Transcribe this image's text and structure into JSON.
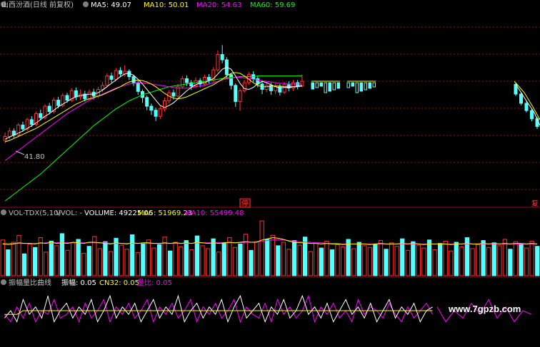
{
  "colors": {
    "up": "#ff3232",
    "down": "#54ffff",
    "ma5": "#ffffff",
    "ma10": "#ffff00",
    "ma20": "#ff00ff",
    "ma60": "#00ff00",
    "label": "#c0c0c0",
    "grid": "#8a1212",
    "watermark": "#ffffff"
  },
  "main_panel": {
    "title": "山西汾酒(日线 前复权)",
    "ma": [
      {
        "label": "MA5: 49.07",
        "color": "#ffffff"
      },
      {
        "label": "MA10: 50.01",
        "color": "#ffff00"
      },
      {
        "label": "MA20: 54.63",
        "color": "#ff00ff"
      },
      {
        "label": "MA60: 59.69",
        "color": "#00ff00"
      }
    ],
    "low_label": "41.80",
    "stop_tag": "停",
    "right_tag": "复"
  },
  "vol_panel": {
    "title": "VOL-TDX(5,10)",
    "vvol": "VVOL: -",
    "items": [
      {
        "label": "VOLUME: 49225.06",
        "color": "#ffffff"
      },
      {
        "label": "MA5: 51969.23",
        "color": "#ffff00"
      },
      {
        "label": "MA10: 55499.48",
        "color": "#ff00ff"
      }
    ]
  },
  "osc_panel": {
    "title": "振幅量比曲线",
    "items": [
      {
        "label": "振幅: 0.05",
        "color": "#ffffff"
      },
      {
        "label": "CN32: 0.05",
        "color": "#ffff00"
      },
      {
        "label": "量比: 0.05",
        "color": "#ff00ff"
      }
    ]
  },
  "watermark": "www.7gpzb.com",
  "chart_data": {
    "type": "candlestick",
    "price_range": [
      38,
      66
    ],
    "candles": [
      [
        47.0,
        47.6,
        48.2,
        46.6
      ],
      [
        47.6,
        48.4,
        48.9,
        47.2
      ],
      [
        48.4,
        47.8,
        48.8,
        47.4
      ],
      [
        47.8,
        49.3,
        49.6,
        47.5
      ],
      [
        49.3,
        48.7,
        49.8,
        48.3
      ],
      [
        48.7,
        50.1,
        50.4,
        48.4
      ],
      [
        50.1,
        49.4,
        50.6,
        49.0
      ],
      [
        49.4,
        51.0,
        51.3,
        49.1
      ],
      [
        51.0,
        50.4,
        51.6,
        50.0
      ],
      [
        50.4,
        52.1,
        52.4,
        50.1
      ],
      [
        52.1,
        51.3,
        52.6,
        50.9
      ],
      [
        51.3,
        53.0,
        53.4,
        51.0
      ],
      [
        53.0,
        52.2,
        53.5,
        51.8
      ],
      [
        52.2,
        53.7,
        54.0,
        51.9
      ],
      [
        53.7,
        53.0,
        54.1,
        52.6
      ],
      [
        53.0,
        54.4,
        54.8,
        52.7
      ],
      [
        54.4,
        53.5,
        54.9,
        53.0
      ],
      [
        53.5,
        53.9,
        54.6,
        53.0
      ],
      [
        53.9,
        53.2,
        54.4,
        52.8
      ],
      [
        53.2,
        54.2,
        54.6,
        52.9
      ],
      [
        54.2,
        53.6,
        54.7,
        53.1
      ],
      [
        53.6,
        54.6,
        55.0,
        53.3
      ],
      [
        54.6,
        55.2,
        55.7,
        54.2
      ],
      [
        55.2,
        56.6,
        57.0,
        54.9
      ],
      [
        56.6,
        56.1,
        57.1,
        55.6
      ],
      [
        56.1,
        57.4,
        57.8,
        55.8
      ],
      [
        57.4,
        56.9,
        57.9,
        56.4
      ],
      [
        56.9,
        57.3,
        58.2,
        56.5
      ],
      [
        57.3,
        56.5,
        57.6,
        56.0
      ],
      [
        56.5,
        55.6,
        56.8,
        55.1
      ],
      [
        55.6,
        54.3,
        55.9,
        53.8
      ],
      [
        54.3,
        53.4,
        54.6,
        52.6
      ],
      [
        53.4,
        52.1,
        53.7,
        51.5
      ],
      [
        52.1,
        51.5,
        52.5,
        50.8
      ],
      [
        51.5,
        50.6,
        51.9,
        49.9
      ],
      [
        50.6,
        51.7,
        52.1,
        50.2
      ],
      [
        51.7,
        52.9,
        53.4,
        51.3
      ],
      [
        52.9,
        54.1,
        54.5,
        52.5
      ],
      [
        54.1,
        53.6,
        54.6,
        53.1
      ],
      [
        53.6,
        55.0,
        55.4,
        53.3
      ],
      [
        55.0,
        56.2,
        56.6,
        54.7
      ],
      [
        56.2,
        55.6,
        56.7,
        55.1
      ],
      [
        55.6,
        55.1,
        56.0,
        54.5
      ],
      [
        55.1,
        55.9,
        56.4,
        54.8
      ],
      [
        55.9,
        55.4,
        56.3,
        54.9
      ],
      [
        55.4,
        56.4,
        56.8,
        55.1
      ],
      [
        56.4,
        56.0,
        56.9,
        55.5
      ],
      [
        56.0,
        57.5,
        57.9,
        55.7
      ],
      [
        57.5,
        59.8,
        60.4,
        57.2
      ],
      [
        59.8,
        59.0,
        61.2,
        58.5
      ],
      [
        59.0,
        56.8,
        59.4,
        56.3
      ],
      [
        56.8,
        55.2,
        57.0,
        54.6
      ],
      [
        55.2,
        52.8,
        55.5,
        52.0
      ],
      [
        52.8,
        54.4,
        54.8,
        51.4
      ],
      [
        54.4,
        55.6,
        56.0,
        54.1
      ],
      [
        55.6,
        56.8,
        57.2,
        55.3
      ],
      [
        56.8,
        56.2,
        57.3,
        55.7
      ],
      [
        56.2,
        55.4,
        56.6,
        54.9
      ],
      [
        55.4,
        54.6,
        55.8,
        53.9
      ],
      [
        54.6,
        55.2,
        55.7,
        54.2
      ],
      [
        55.2,
        54.4,
        55.6,
        53.8
      ],
      [
        54.4,
        55.0,
        55.5,
        53.9
      ],
      [
        55.0,
        54.2,
        55.4,
        53.7
      ],
      [
        54.2,
        55.3,
        55.7,
        53.9
      ],
      [
        55.3,
        54.8,
        55.8,
        54.3
      ],
      [
        54.8,
        55.6,
        56.0,
        54.4
      ],
      [
        55.6,
        55.1,
        56.0,
        54.6
      ],
      [
        55.1,
        55.8,
        56.8,
        54.9
      ]
    ],
    "ma5": [
      47.2,
      47.5,
      47.8,
      48.1,
      48.4,
      48.8,
      49.2,
      49.6,
      50.1,
      50.6,
      51.0,
      51.5,
      52.0,
      52.4,
      52.8,
      53.2,
      53.5,
      53.7,
      53.8,
      53.9,
      53.9,
      54.1,
      54.5,
      55.0,
      55.5,
      56.0,
      56.5,
      56.9,
      57.0,
      56.7,
      56.1,
      55.4,
      54.6,
      53.8,
      53.0,
      52.2,
      51.9,
      52.2,
      52.6,
      53.2,
      53.8,
      54.4,
      54.9,
      55.3,
      55.6,
      55.6,
      55.9,
      56.2,
      56.9,
      57.6,
      57.9,
      57.6,
      56.6,
      55.5,
      54.7,
      54.6,
      54.9,
      55.4,
      55.8,
      55.6,
      55.3,
      55.0,
      54.8,
      54.9,
      54.9,
      55.0,
      55.0,
      55.2
    ],
    "ma10": [
      46.8,
      47.0,
      47.3,
      47.6,
      47.9,
      48.2,
      48.5,
      48.8,
      49.2,
      49.6,
      50.0,
      50.4,
      50.8,
      51.2,
      51.6,
      52.0,
      52.4,
      52.7,
      53.0,
      53.2,
      53.4,
      53.6,
      53.8,
      54.1,
      54.4,
      54.7,
      55.0,
      55.4,
      55.7,
      55.9,
      56.0,
      55.9,
      55.7,
      55.4,
      55.0,
      54.5,
      54.0,
      53.6,
      53.3,
      53.2,
      53.3,
      53.5,
      53.8,
      54.1,
      54.4,
      54.7,
      55.0,
      55.3,
      55.7,
      56.1,
      56.6,
      57.0,
      57.1,
      57.0,
      56.6,
      56.1,
      55.6,
      55.2,
      55.0,
      55.0,
      55.1,
      55.1,
      55.1,
      55.0,
      55.0,
      55.0,
      55.0,
      55.1
    ],
    "ma20": [
      44.0,
      44.5,
      45.0,
      45.5,
      46.0,
      46.5,
      47.0,
      47.5,
      48.0,
      48.5,
      49.0,
      49.5,
      50.0,
      50.5,
      51.0,
      51.4,
      51.8,
      52.2,
      52.6,
      53.0,
      53.3,
      53.6,
      53.9,
      54.2,
      54.5,
      54.8,
      55.0,
      55.2,
      55.4,
      55.5,
      55.6,
      55.6,
      55.5,
      55.4,
      55.3,
      55.2,
      55.1,
      55.0,
      54.9,
      54.8,
      54.8,
      54.8,
      54.9,
      55.0,
      55.1,
      55.2,
      55.4,
      55.6,
      55.8,
      56.0,
      56.2,
      56.3,
      56.4,
      56.4,
      56.3,
      56.2,
      56.1,
      56.0,
      55.9,
      55.8,
      55.7,
      55.6,
      55.5,
      55.5,
      55.4,
      55.4,
      55.4,
      55.4
    ],
    "ma60": [
      38.0,
      38.5,
      39.0,
      39.5,
      40.0,
      40.5,
      41.0,
      41.5,
      42.0,
      42.6,
      43.2,
      43.8,
      44.4,
      45.0,
      45.6,
      46.2,
      46.8,
      47.4,
      48.0,
      48.6,
      49.2,
      49.7,
      50.2,
      50.7,
      51.2,
      51.7,
      52.1,
      52.5,
      52.9,
      53.2,
      53.5,
      53.8,
      54.0,
      54.2,
      54.4,
      54.6,
      54.8,
      55.0,
      55.1,
      55.2,
      55.3,
      55.4,
      55.5,
      55.6,
      55.7,
      55.8,
      55.9,
      56.0,
      56.1,
      56.2,
      56.3,
      56.4,
      56.4,
      56.5,
      56.5,
      56.5,
      56.5,
      56.6,
      56.6,
      56.6,
      56.6,
      56.6,
      56.6,
      56.6,
      56.6,
      56.6,
      56.6,
      56.6
    ],
    "right_fragment": [
      [
        59.3,
        57.3,
        59.6,
        56.9
      ],
      [
        57.3,
        55.4,
        57.6,
        55.0
      ],
      [
        55.4,
        53.9,
        55.8,
        53.5
      ],
      [
        53.9,
        52.2,
        54.3,
        51.7
      ],
      [
        52.2,
        50.6,
        52.6,
        50.1
      ]
    ],
    "volume": [
      62,
      45,
      58,
      70,
      38,
      55,
      49,
      66,
      41,
      60,
      52,
      73,
      44,
      57,
      63,
      39,
      51,
      68,
      47,
      59,
      42,
      65,
      53,
      46,
      71,
      40,
      56,
      62,
      48,
      54,
      67,
      43,
      58,
      50,
      61,
      45,
      69,
      52,
      47,
      64,
      41,
      57,
      66,
      49,
      55,
      72,
      44,
      59,
      95,
      63,
      70,
      52,
      58,
      46,
      61,
      53,
      67,
      42,
      56,
      48,
      60,
      45,
      54,
      50,
      63,
      47,
      58,
      52,
      49,
      55,
      61,
      46,
      57,
      51,
      64,
      44,
      59,
      53,
      48,
      62,
      45,
      56,
      60,
      43,
      58,
      50,
      66,
      47,
      54,
      61,
      49,
      57,
      52,
      63,
      46,
      59,
      55,
      48,
      60,
      51
    ],
    "vol_ma5": [
      55,
      54,
      55,
      57,
      56,
      56,
      55,
      57,
      56,
      58,
      56,
      57,
      56,
      58,
      57,
      56,
      58,
      58,
      57,
      56,
      55,
      57,
      56,
      55,
      57,
      56,
      57,
      57,
      56,
      56,
      57,
      56,
      57,
      56,
      57,
      56,
      58,
      57,
      56,
      57,
      56,
      57,
      58,
      57,
      58,
      59,
      58,
      58,
      62,
      64,
      66,
      65,
      63,
      60,
      58,
      57,
      57,
      56,
      56,
      55,
      56,
      55,
      55,
      54,
      55,
      55,
      55,
      55,
      54,
      55,
      56,
      55,
      55,
      55,
      56,
      55,
      56,
      55,
      54,
      55,
      55,
      55,
      55,
      54,
      55,
      55,
      56,
      55,
      55,
      56,
      55,
      56,
      55,
      56,
      55,
      56,
      56,
      55,
      56,
      55
    ],
    "vol_ma10": [
      56,
      56,
      56,
      56,
      56,
      56,
      56,
      56,
      57,
      57,
      57,
      57,
      57,
      57,
      57,
      57,
      57,
      57,
      57,
      57,
      56,
      56,
      56,
      56,
      56,
      56,
      56,
      56,
      56,
      56,
      56,
      56,
      56,
      56,
      56,
      56,
      57,
      57,
      57,
      57,
      57,
      57,
      57,
      57,
      57,
      58,
      58,
      59,
      60,
      61,
      62,
      62,
      62,
      61,
      60,
      59,
      58,
      58,
      57,
      57,
      56,
      56,
      56,
      55,
      55,
      55,
      55,
      55,
      55,
      55,
      55,
      55,
      55,
      55,
      55,
      55,
      55,
      55,
      55,
      55,
      55,
      55,
      55,
      55,
      55,
      55,
      55,
      55,
      55,
      55,
      55,
      55,
      55,
      55,
      55,
      55,
      55,
      55,
      55,
      55
    ],
    "osc_white": [
      0.3,
      0.5,
      0.2,
      0.8,
      0.4,
      0.6,
      0.3,
      0.9,
      0.2,
      0.5,
      0.7,
      0.3,
      0.6,
      0.4,
      0.8,
      0.2,
      0.5,
      0.9,
      0.3,
      0.6,
      0.4,
      0.7,
      0.2,
      0.5,
      0.8,
      0.3,
      0.6,
      0.4,
      0.9,
      0.2,
      0.5,
      0.7,
      0.3,
      0.6,
      0.4,
      0.8,
      0.2,
      0.6,
      0.9,
      0.3,
      0.5,
      0.7,
      0.2,
      0.6,
      0.4,
      0.8,
      0.3,
      0.5,
      0.9,
      0.4,
      0.6,
      0.3,
      0.7,
      0.2,
      0.5,
      0.8,
      0.4,
      0.6,
      0.3,
      0.7,
      0.2,
      0.5,
      0.8,
      0.3,
      0.6,
      0.4,
      0.7,
      0.2,
      0.5,
      0.6
    ],
    "osc_magenta": [
      0.4,
      0.2,
      0.6,
      0.3,
      0.7,
      0.2,
      0.5,
      0.4,
      0.8,
      0.3,
      0.4,
      0.6,
      0.2,
      0.7,
      0.3,
      0.5,
      0.8,
      0.2,
      0.6,
      0.4,
      0.7,
      0.3,
      0.5,
      0.8,
      0.2,
      0.6,
      0.4,
      0.7,
      0.3,
      0.5,
      0.8,
      0.2,
      0.6,
      0.4,
      0.7,
      0.3,
      0.5,
      0.8,
      0.2,
      0.6,
      0.4,
      0.3,
      0.7,
      0.2,
      0.8,
      0.4,
      0.6,
      0.3,
      0.5,
      0.9,
      0.2,
      0.6,
      0.4,
      0.7,
      0.3,
      0.5,
      0.2,
      0.8,
      0.4,
      0.6,
      0.5,
      0.3,
      0.7,
      0.4,
      0.2,
      0.6,
      0.3,
      0.5,
      0.7,
      0.4
    ],
    "osc_yellow": [
      0.4,
      0.4,
      0.4,
      0.5,
      0.5,
      0.5,
      0.5,
      0.5,
      0.5,
      0.5,
      0.5,
      0.5,
      0.5,
      0.5,
      0.5,
      0.5,
      0.5,
      0.5,
      0.5,
      0.5,
      0.5,
      0.5,
      0.5,
      0.5,
      0.5,
      0.5,
      0.5,
      0.5,
      0.5,
      0.5,
      0.5,
      0.5,
      0.5,
      0.5,
      0.5,
      0.5,
      0.5,
      0.5,
      0.5,
      0.5,
      0.5,
      0.5,
      0.5,
      0.5,
      0.5,
      0.5,
      0.5,
      0.5,
      0.5,
      0.5,
      0.5,
      0.5,
      0.5,
      0.5,
      0.5,
      0.5,
      0.5,
      0.5,
      0.5,
      0.5,
      0.5,
      0.5,
      0.5,
      0.5,
      0.5,
      0.5,
      0.5,
      0.5,
      0.5,
      0.5
    ],
    "osc_fragment": [
      0.6,
      0.2,
      0.5,
      0.3,
      0.7,
      0.4,
      0.8,
      0.3,
      0.6,
      0.2,
      0.5,
      0.4
    ]
  }
}
